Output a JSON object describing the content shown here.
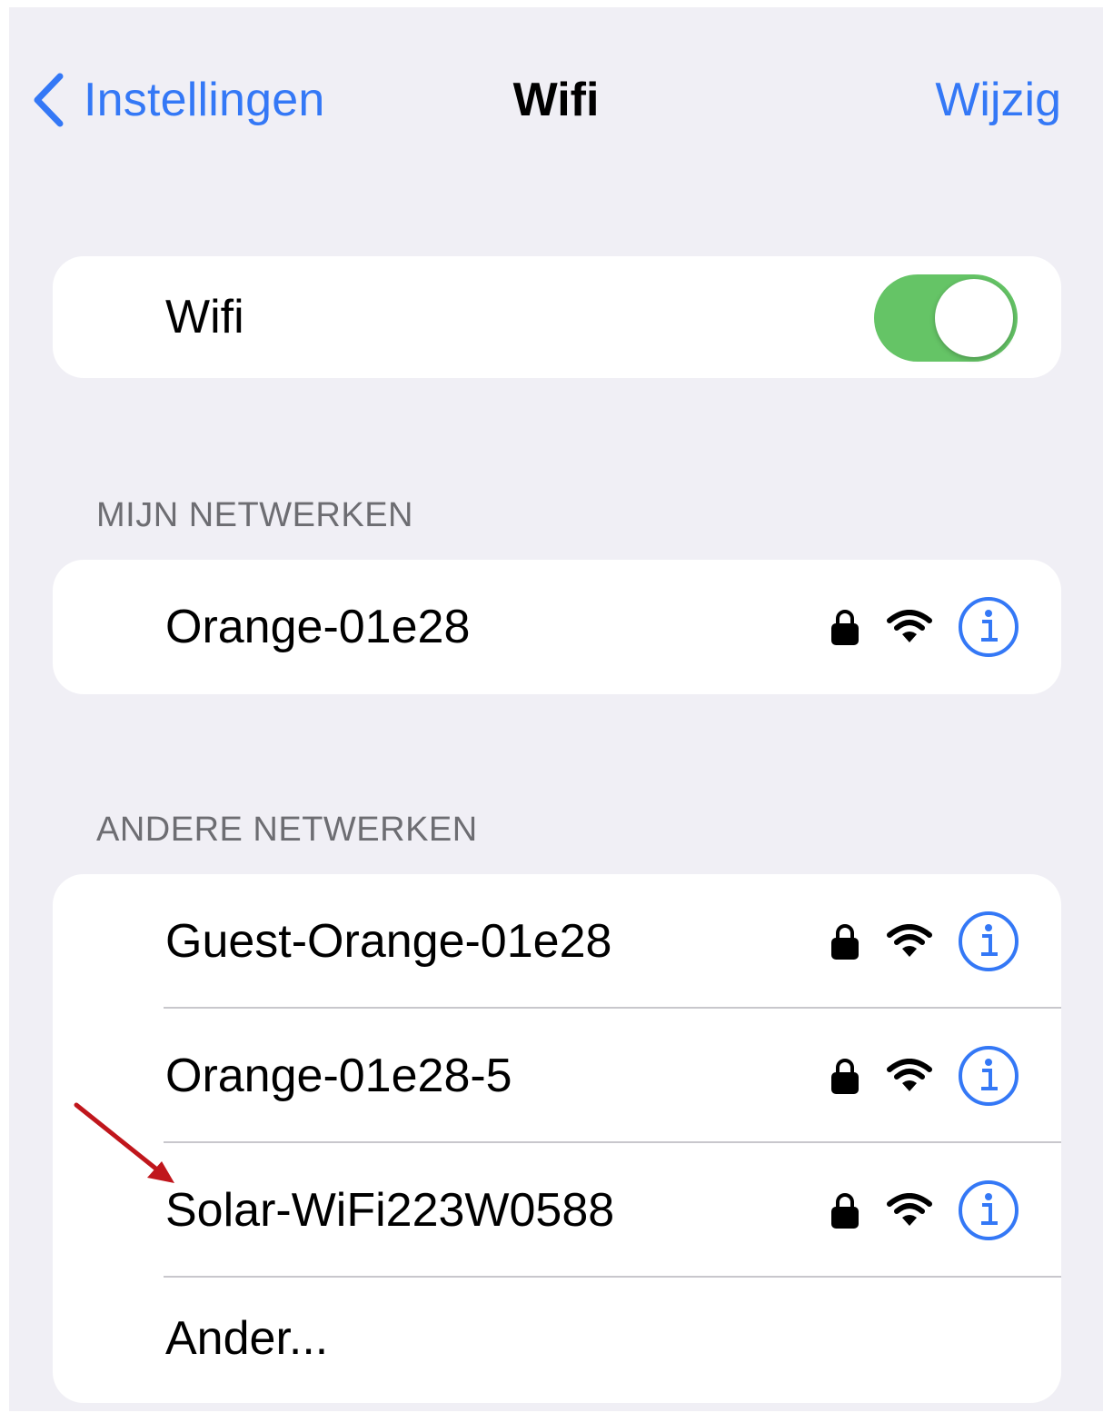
{
  "nav": {
    "back_label": "Instellingen",
    "title": "Wifi",
    "edit_label": "Wijzig"
  },
  "wifi_toggle": {
    "label": "Wifi",
    "state": "on"
  },
  "my_networks": {
    "header": "MIJN NETWERKEN",
    "items": [
      {
        "name": "Orange-01e28",
        "secured": true
      }
    ]
  },
  "other_networks": {
    "header": "ANDERE NETWERKEN",
    "items": [
      {
        "name": "Guest-Orange-01e28",
        "secured": true
      },
      {
        "name": "Orange-01e28-5",
        "secured": true
      },
      {
        "name": "Solar-WiFi223W0588",
        "secured": true
      }
    ],
    "other_label": "Ander..."
  },
  "icons": {
    "back": "chevron-left-icon",
    "lock": "lock-icon",
    "signal": "wifi-signal-icon",
    "info": "info-icon",
    "annotation": "red-arrow-icon"
  },
  "colors": {
    "accent": "#3478f6",
    "toggle_on": "#65c466",
    "background": "#f0eff5",
    "section_header": "#6d6d72",
    "annotation_arrow": "#c0161c"
  }
}
